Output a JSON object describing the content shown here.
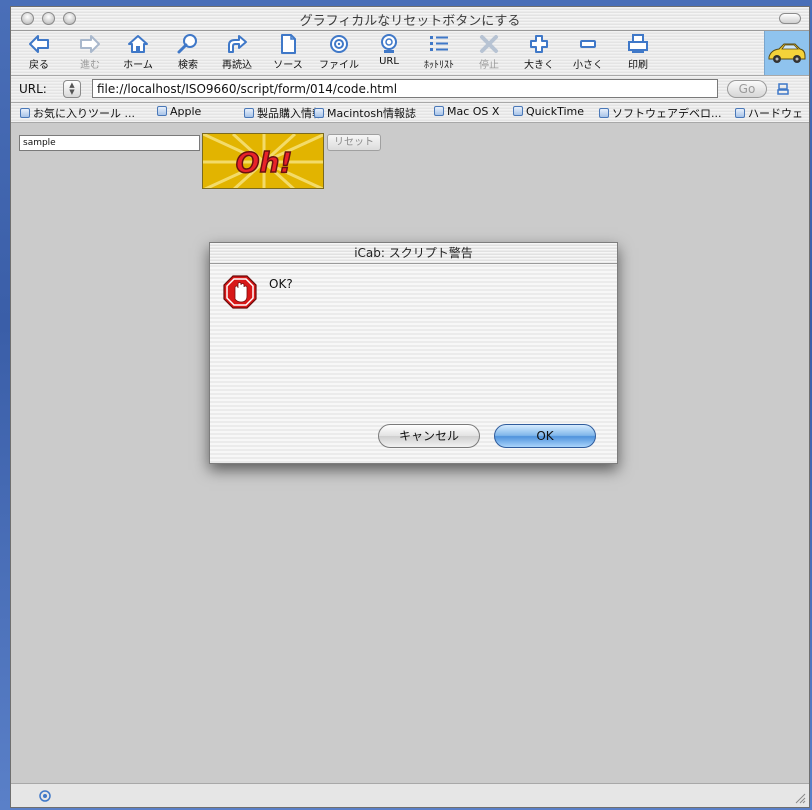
{
  "window": {
    "title": "グラフィカルなリセットボタンにする"
  },
  "toolbar": {
    "buttons": [
      {
        "label": "戻る",
        "icon": "back-arrow-icon",
        "enabled": true
      },
      {
        "label": "進む",
        "icon": "forward-arrow-icon",
        "enabled": false
      },
      {
        "label": "ホーム",
        "icon": "home-icon",
        "enabled": true
      },
      {
        "label": "検索",
        "icon": "search-icon",
        "enabled": true
      },
      {
        "label": "再読込",
        "icon": "reload-icon",
        "enabled": true
      },
      {
        "label": "ソース",
        "icon": "source-icon",
        "enabled": true
      },
      {
        "label": "ファイル",
        "icon": "file-icon",
        "enabled": true
      },
      {
        "label": "URL",
        "icon": "url-icon",
        "enabled": true
      },
      {
        "label": "ﾎｯﾄﾘｽﾄ",
        "icon": "hotlist-icon",
        "enabled": true
      },
      {
        "label": "停止",
        "icon": "stop-x-icon",
        "enabled": false
      },
      {
        "label": "大きく",
        "icon": "plus-icon",
        "enabled": true
      },
      {
        "label": "小さく",
        "icon": "minus-icon",
        "enabled": true
      },
      {
        "label": "印刷",
        "icon": "print-icon",
        "enabled": true
      }
    ]
  },
  "urlbar": {
    "label": "URL:",
    "value": "file://localhost/ISO9660/script/form/014/code.html",
    "go_label": "Go"
  },
  "favorites": [
    "お気に入りツール ...",
    "Apple",
    "製品購入情報",
    "Macintosh情報誌",
    "Mac OS X",
    "QuickTime",
    "ソフトウェアデベロ...",
    "ハードウェ"
  ],
  "page": {
    "text_field_value": "sample",
    "image_button_text": "Oh!",
    "reset_label": "リセット"
  },
  "dialog": {
    "title": "iCab: スクリプト警告",
    "message": "OK?",
    "cancel_label": "キャンセル",
    "ok_label": "OK"
  },
  "colors": {
    "accent_blue": "#4e92dc",
    "stop_red": "#d81818",
    "image_yellow": "#e2b400"
  }
}
